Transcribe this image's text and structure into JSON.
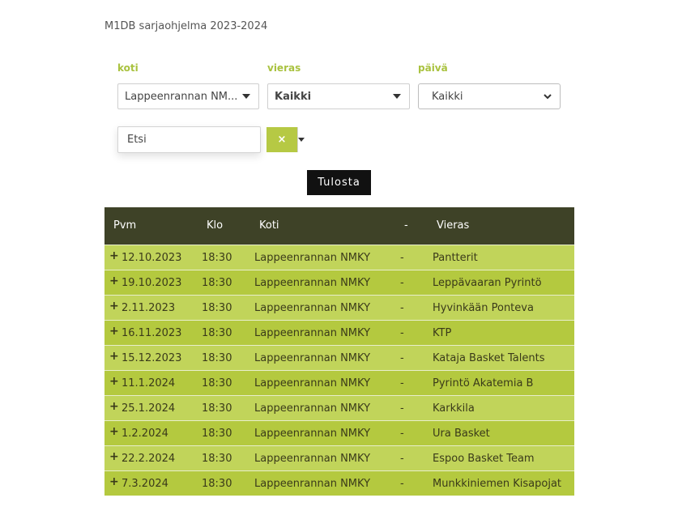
{
  "page": {
    "title": "M1DB sarjaohjelma 2023-2024"
  },
  "filters": {
    "home": {
      "label": "koti",
      "value": "Lappeenrannan NM..."
    },
    "away": {
      "label": "vieras",
      "value": "Kaikki"
    },
    "date": {
      "label": "päivä",
      "value": "Kaikki"
    }
  },
  "search": {
    "placeholder": "Etsi",
    "clear_label": "×"
  },
  "print_label": "Tulosta",
  "table": {
    "headers": {
      "date": "Pvm",
      "time": "Klo",
      "home": "Koti",
      "sep": "-",
      "away": "Vieras"
    },
    "rows": [
      {
        "expand": "+",
        "date": "12.10.2023",
        "time": "18:30",
        "home": "Lappeenrannan NMKY",
        "sep": "-",
        "away": "Pantterit"
      },
      {
        "expand": "+",
        "date": "19.10.2023",
        "time": "18:30",
        "home": "Lappeenrannan NMKY",
        "sep": "-",
        "away": "Leppävaaran Pyrintö"
      },
      {
        "expand": "+",
        "date": "2.11.2023",
        "time": "18:30",
        "home": "Lappeenrannan NMKY",
        "sep": "-",
        "away": "Hyvinkään Ponteva"
      },
      {
        "expand": "+",
        "date": "16.11.2023",
        "time": "18:30",
        "home": "Lappeenrannan NMKY",
        "sep": "-",
        "away": "KTP"
      },
      {
        "expand": "+",
        "date": "15.12.2023",
        "time": "18:30",
        "home": "Lappeenrannan NMKY",
        "sep": "-",
        "away": "Kataja Basket Talents"
      },
      {
        "expand": "+",
        "date": "11.1.2024",
        "time": "18:30",
        "home": "Lappeenrannan NMKY",
        "sep": "-",
        "away": "Pyrintö Akatemia B"
      },
      {
        "expand": "+",
        "date": "25.1.2024",
        "time": "18:30",
        "home": "Lappeenrannan NMKY",
        "sep": "-",
        "away": "Karkkila"
      },
      {
        "expand": "+",
        "date": "1.2.2024",
        "time": "18:30",
        "home": "Lappeenrannan NMKY",
        "sep": "-",
        "away": "Ura Basket"
      },
      {
        "expand": "+",
        "date": "22.2.2024",
        "time": "18:30",
        "home": "Lappeenrannan NMKY",
        "sep": "-",
        "away": "Espoo Basket Team"
      },
      {
        "expand": "+",
        "date": "7.3.2024",
        "time": "18:30",
        "home": "Lappeenrannan NMKY",
        "sep": "-",
        "away": "Munkkiniemen Kisapojat"
      }
    ]
  },
  "colors": {
    "accent": "#b6c944",
    "header_bg": "#3e4227",
    "row_odd": "#c1d45a",
    "row_even": "#b4c93f"
  }
}
